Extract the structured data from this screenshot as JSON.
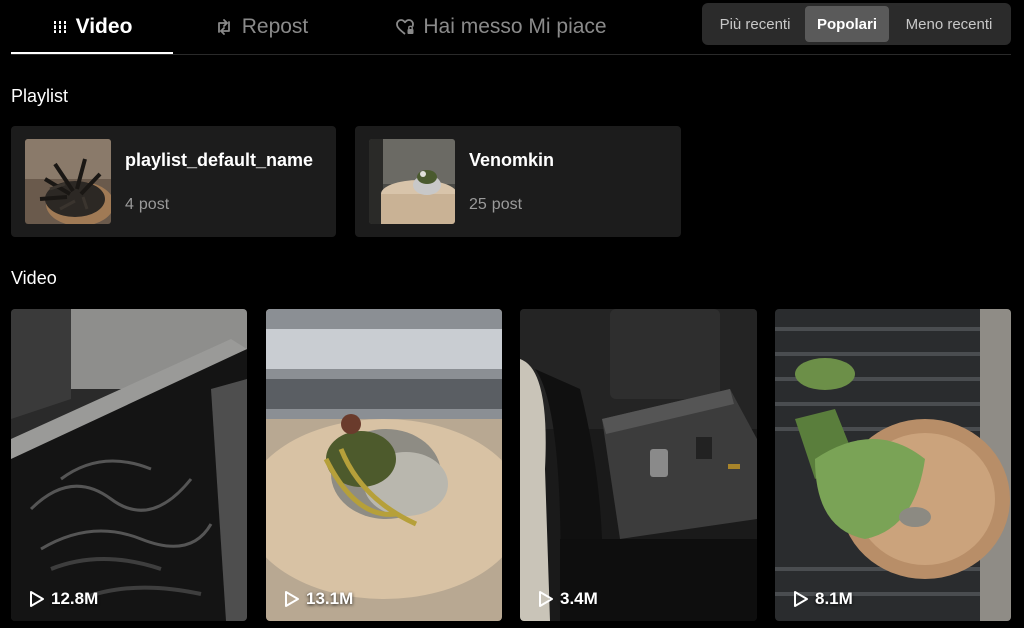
{
  "tabs": {
    "video": {
      "label": "Video",
      "icon": "grid-lines-icon",
      "active": true
    },
    "repost": {
      "label": "Repost",
      "icon": "repost-icon"
    },
    "liked": {
      "label": "Hai messo Mi piace",
      "icon": "heart-lock-icon"
    }
  },
  "sort": {
    "recent": "Più recenti",
    "popular": "Popolari",
    "oldest": "Meno recenti",
    "selected": "Popolari"
  },
  "playlists": {
    "title": "Playlist",
    "items": [
      {
        "name": "playlist_default_name",
        "count": "4",
        "unit": "post"
      },
      {
        "name": "Venomkin",
        "count": "25",
        "unit": "post"
      }
    ]
  },
  "videos": {
    "title": "Video",
    "items": [
      {
        "views": "12.8M"
      },
      {
        "views": "13.1M"
      },
      {
        "views": "3.4M"
      },
      {
        "views": "8.1M"
      }
    ]
  },
  "colors": {
    "background": "#000000",
    "card": "#1c1c1c",
    "muted_text": "#8a8a8a",
    "sort_bg": "#2b2b2b",
    "sort_active": "#5a5a5a"
  }
}
